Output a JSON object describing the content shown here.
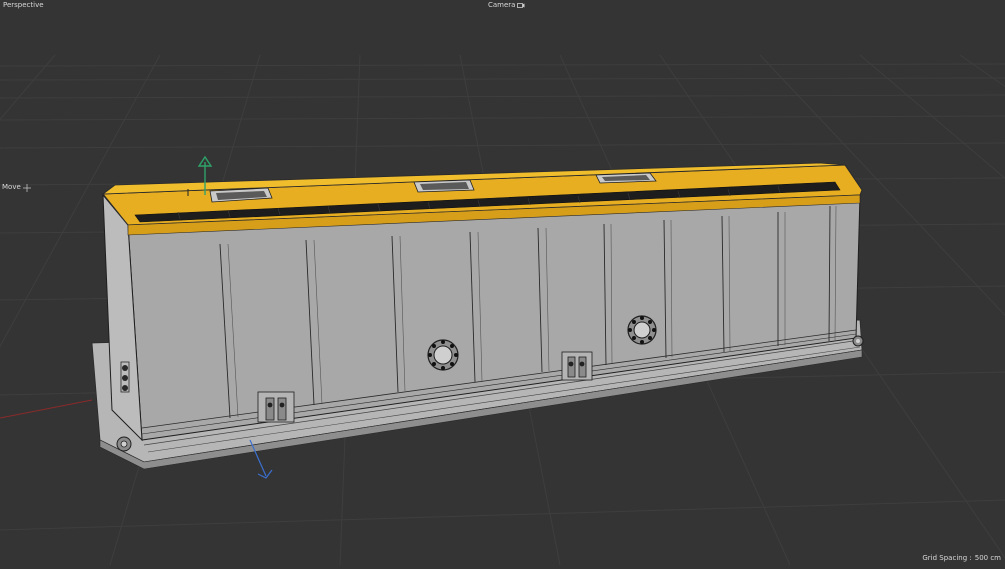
{
  "viewport": {
    "view_name": "Perspective",
    "camera_label": "Camera",
    "camera_icon": "camera-icon",
    "tool_name": "Move",
    "tool_icon": "move-cross-icon",
    "grid_spacing_label": "Grid Spacing :",
    "grid_spacing_value": "500 cm"
  },
  "colors": {
    "background": "#343434",
    "grid": "#3d3d3d",
    "model_body": "#a9a9a9",
    "model_highlight": "#e7ae22",
    "axis_y": "#2ea36a",
    "axis_z": "#3b6fd0",
    "axis_x": "#b03030"
  }
}
